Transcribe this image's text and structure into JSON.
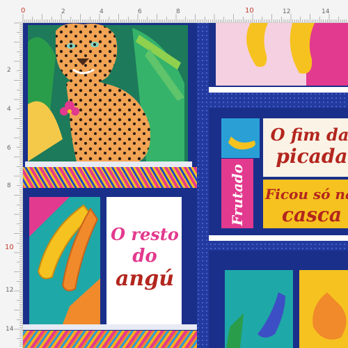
{
  "ruler": {
    "top_labels": [
      "0",
      "2",
      "4",
      "6",
      "8",
      "10",
      "12",
      "14"
    ],
    "left_labels": [
      "2",
      "4",
      "6",
      "8",
      "10",
      "12",
      "14"
    ],
    "highlight_label": "10"
  },
  "artwork": {
    "panel_top_right_line1": "O fim da",
    "panel_top_right_line2": "picada",
    "panel_vertical": "Frutado",
    "panel_mid_right_line1": "Ficou só na",
    "panel_mid_right_line2": "casca",
    "panel_left_line1": "O resto",
    "panel_left_line2": "do",
    "panel_left_line3": "angú",
    "colors": {
      "deep_blue": "#1a2f8a",
      "frame_blue": "#2746c9",
      "orange": "#f08a2b",
      "pink": "#e23a8e",
      "yellow": "#f6c21f",
      "text_red": "#b3261e"
    },
    "icons": [
      "jaguar-illustration",
      "banana-illustration",
      "pear-illustration",
      "leaf-illustration",
      "flower-illustration"
    ]
  }
}
